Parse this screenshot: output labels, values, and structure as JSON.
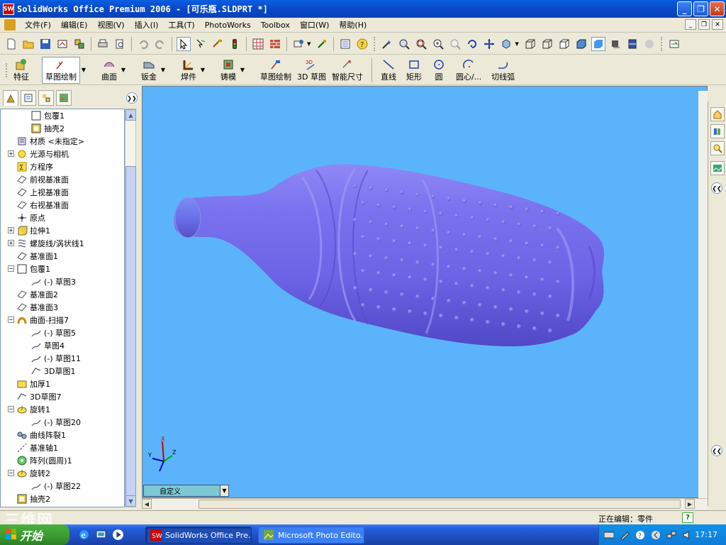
{
  "window": {
    "title": "SolidWorks Office Premium 2006 - [可乐瓶.SLDPRT *]",
    "app_icon_text": "SW",
    "minimize": "_",
    "maximize": "❐",
    "close": "✕"
  },
  "menu": {
    "items": [
      "文件(F)",
      "编辑(E)",
      "视图(V)",
      "插入(I)",
      "工具(T)",
      "PhotoWorks",
      "Toolbox",
      "窗口(W)",
      "帮助(H)"
    ],
    "doc_buttons": [
      "_",
      "❐",
      "✕"
    ]
  },
  "command_manager": {
    "items": [
      {
        "label": "特征",
        "icon": "features-icon",
        "dropdown": false
      },
      {
        "label": "草图绘制",
        "icon": "sketch-icon",
        "dropdown": true,
        "active": true
      },
      {
        "label": "曲面",
        "icon": "surfaces-icon",
        "dropdown": true
      },
      {
        "label": "钣金",
        "icon": "sheet-metal-icon",
        "dropdown": true
      },
      {
        "label": "焊件",
        "icon": "weldments-icon",
        "dropdown": true
      },
      {
        "label": "铸模",
        "icon": "mold-tools-icon",
        "dropdown": true
      },
      {
        "label": "草图绘制",
        "icon": "sketch-icon",
        "dropdown": false
      },
      {
        "label": "3D 草图",
        "icon": "3d-sketch-icon",
        "dropdown": false
      },
      {
        "label": "智能尺寸",
        "icon": "smart-dimension-icon",
        "dropdown": false
      },
      {
        "label": "直线",
        "icon": "line-icon",
        "dropdown": false
      },
      {
        "label": "矩形",
        "icon": "rectangle-icon",
        "dropdown": false
      },
      {
        "label": "圆",
        "icon": "circle-icon",
        "dropdown": false
      },
      {
        "label": "圆心/...",
        "icon": "centerpoint-arc-icon",
        "dropdown": false
      },
      {
        "label": "切线弧",
        "icon": "tangent-arc-icon",
        "dropdown": false
      }
    ]
  },
  "feature_tree": {
    "items": [
      {
        "label": "包覆1",
        "level": 2,
        "icon": "wrap-icon",
        "expander": ""
      },
      {
        "label": "抽壳2",
        "level": 2,
        "icon": "shell-icon",
        "expander": ""
      },
      {
        "label": "材质 <未指定>",
        "level": 1,
        "icon": "material-icon",
        "expander": ""
      },
      {
        "label": "光源与相机",
        "level": 1,
        "icon": "lights-icon",
        "expander": "+"
      },
      {
        "label": "方程序",
        "level": 1,
        "icon": "equations-icon",
        "expander": ""
      },
      {
        "label": "前视基准面",
        "level": 1,
        "icon": "plane-icon",
        "expander": ""
      },
      {
        "label": "上视基准面",
        "level": 1,
        "icon": "plane-icon",
        "expander": ""
      },
      {
        "label": "右视基准面",
        "level": 1,
        "icon": "plane-icon",
        "expander": ""
      },
      {
        "label": "原点",
        "level": 1,
        "icon": "origin-icon",
        "expander": ""
      },
      {
        "label": "拉伸1",
        "level": 1,
        "icon": "extrude-icon",
        "expander": "+"
      },
      {
        "label": "螺旋线/涡状线1",
        "level": 1,
        "icon": "helix-icon",
        "expander": "+"
      },
      {
        "label": "基准面1",
        "level": 1,
        "icon": "plane-icon",
        "expander": ""
      },
      {
        "label": "包覆1",
        "level": 1,
        "icon": "wrap-icon",
        "expander": "−"
      },
      {
        "label": "(-) 草图3",
        "level": 2,
        "icon": "sketch-icon",
        "expander": ""
      },
      {
        "label": "基准面2",
        "level": 1,
        "icon": "plane-icon",
        "expander": ""
      },
      {
        "label": "基准面3",
        "level": 1,
        "icon": "plane-icon",
        "expander": ""
      },
      {
        "label": "曲面-扫描7",
        "level": 1,
        "icon": "surface-sweep-icon",
        "expander": "−"
      },
      {
        "label": "(-) 草图5",
        "level": 2,
        "icon": "sketch-icon",
        "expander": ""
      },
      {
        "label": "草图4",
        "level": 2,
        "icon": "sketch-icon",
        "expander": ""
      },
      {
        "label": "(-) 草图11",
        "level": 2,
        "icon": "sketch-icon",
        "expander": ""
      },
      {
        "label": "3D草图1",
        "level": 2,
        "icon": "3d-sketch-icon",
        "expander": ""
      },
      {
        "label": "加厚1",
        "level": 1,
        "icon": "thicken-icon",
        "expander": ""
      },
      {
        "label": "3D草图7",
        "level": 1,
        "icon": "3d-sketch-icon",
        "expander": ""
      },
      {
        "label": "旋转1",
        "level": 1,
        "icon": "revolve-icon",
        "expander": "−"
      },
      {
        "label": "(-) 草图20",
        "level": 2,
        "icon": "sketch-icon",
        "expander": ""
      },
      {
        "label": "曲线阵裂1",
        "level": 1,
        "icon": "curve-pattern-icon",
        "expander": ""
      },
      {
        "label": "基准轴1",
        "level": 1,
        "icon": "axis-icon",
        "expander": ""
      },
      {
        "label": "阵列(圆周)1",
        "level": 1,
        "icon": "circular-pattern-icon",
        "expander": ""
      },
      {
        "label": "旋转2",
        "level": 1,
        "icon": "revolve-icon",
        "expander": "−"
      },
      {
        "label": "(-) 草图22",
        "level": 2,
        "icon": "sketch-icon",
        "expander": ""
      },
      {
        "label": "抽壳2",
        "level": 1,
        "icon": "shell-icon",
        "expander": ""
      }
    ]
  },
  "viewport": {
    "background": "#5bb4fb",
    "model_color": "#7b72f0",
    "triad": {
      "x": "X",
      "y": "Y",
      "z": "Z"
    }
  },
  "config_combo": {
    "value": "自定义"
  },
  "status": {
    "text": "正在编辑：零件",
    "help": "?"
  },
  "watermark": "三维网",
  "taskbar": {
    "start_label": "开始",
    "tasks": [
      {
        "label": "SolidWorks Office Pre...",
        "active": true
      },
      {
        "label": "Microsoft Photo Edito...",
        "active": false
      }
    ],
    "clock": "17:17"
  }
}
